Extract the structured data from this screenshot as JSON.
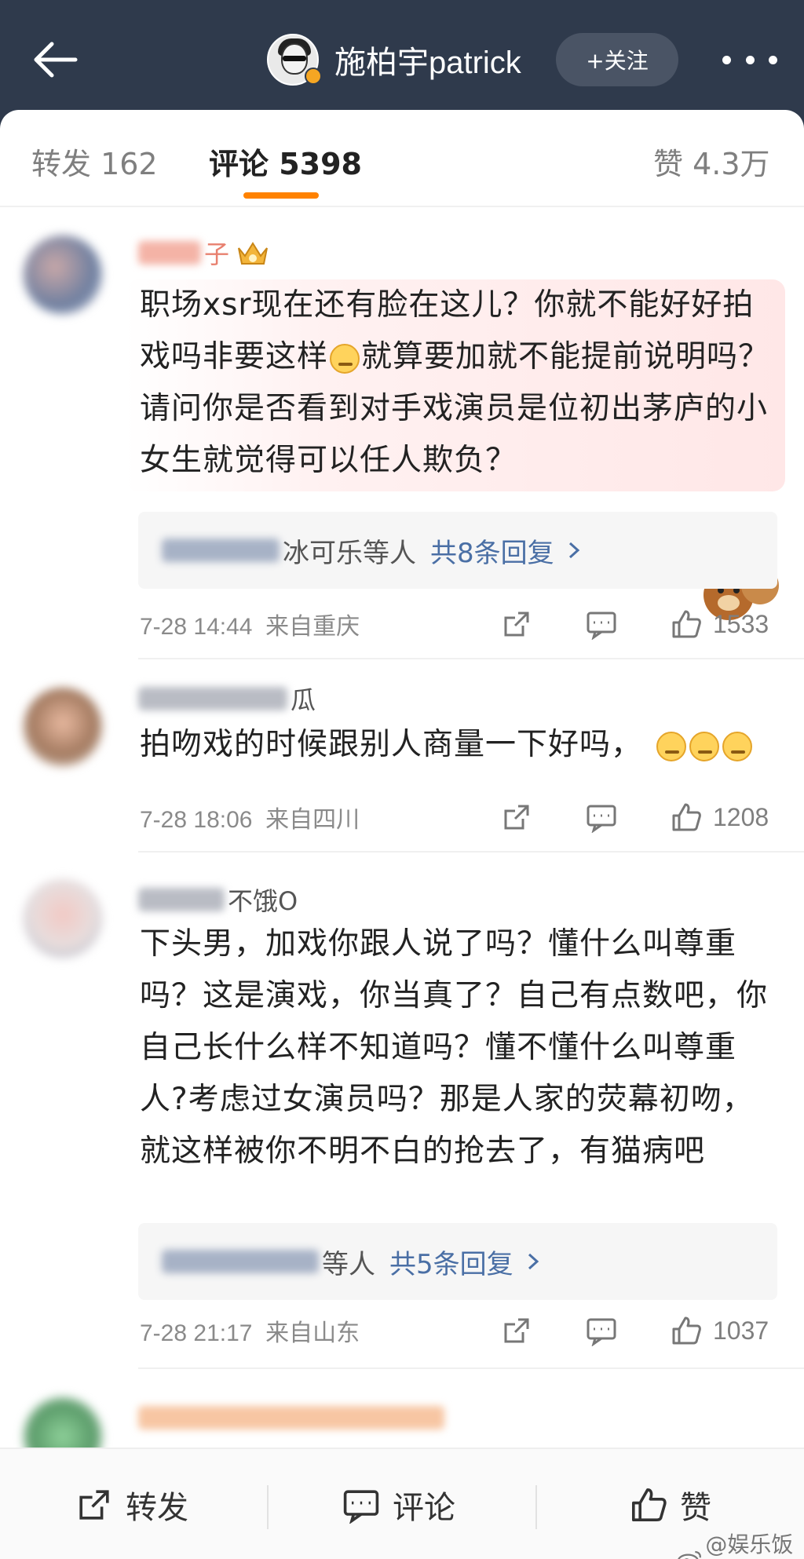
{
  "header": {
    "author_name": "施柏宇patrick",
    "follow_label": "+关注",
    "colors": {
      "bar_bg": "#2f3a4c",
      "verified_badge": "#f5a623"
    }
  },
  "tabs": [
    {
      "label": "转发 162",
      "active": false
    },
    {
      "label": "评论 5398",
      "active": true
    },
    {
      "label": "赞 4.3万",
      "active": false
    }
  ],
  "accent_color": "#ff8200",
  "comments": [
    {
      "name_visible": "子",
      "badge_icon": "crown-badge-icon",
      "text": "职场xsr现在还有脸在这儿？你就不能好好拍戏吗非要这样",
      "text_after_emoji": "就算要加就不能提前说明吗？请问你是否看到对手戏演员是位初出茅庐的小女生就觉得可以任人欺负？",
      "replies_names": "冰可乐等人",
      "replies_count": "共8条回复",
      "time": "7-28 14:44  来自重庆",
      "likes": "1533"
    },
    {
      "name_visible": "瓜",
      "text": "拍吻戏的时候跟别人商量一下好吗，",
      "time": "7-28 18:06  来自四川",
      "likes": "1208"
    },
    {
      "name_visible": "不饿O",
      "text": "下头男，加戏你跟人说了吗？懂什么叫尊重吗？这是演戏，你当真了？自己有点数吧，你自己长什么样不知道吗？懂不懂什么叫尊重人?考虑过女演员吗？那是人家的荧幕初吻，就这样被你不明不白的抢去了，有猫病吧",
      "replies_names": "等人",
      "replies_count": "共5条回复",
      "time": "7-28 21:17  来自山东",
      "likes": "1037"
    }
  ],
  "bottom_bar": {
    "repost_label": "转发",
    "comment_label": "评论",
    "like_label": "赞"
  },
  "watermark": "@娱乐饭桶"
}
